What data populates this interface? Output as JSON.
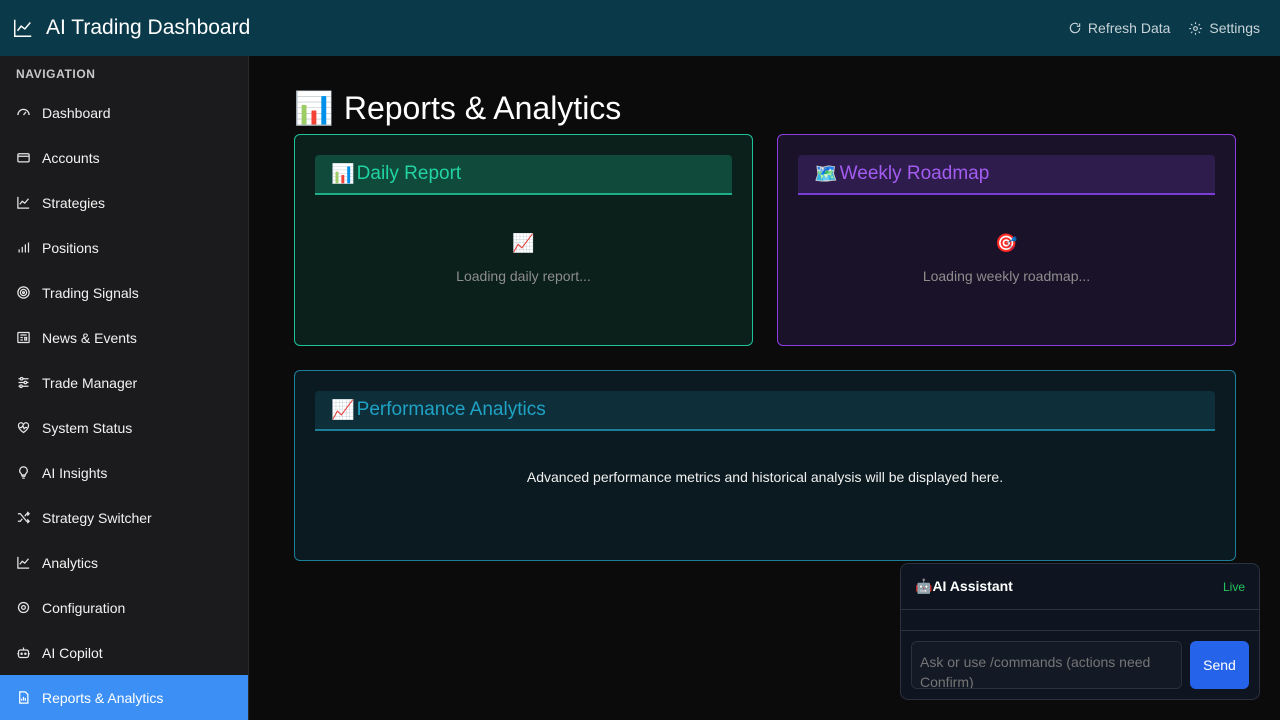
{
  "header": {
    "title": "AI Trading Dashboard",
    "refresh_label": "Refresh Data",
    "settings_label": "Settings"
  },
  "sidebar": {
    "heading": "NAVIGATION",
    "items": [
      {
        "label": "Dashboard",
        "icon": "gauge-icon"
      },
      {
        "label": "Accounts",
        "icon": "wallet-icon"
      },
      {
        "label": "Strategies",
        "icon": "line-chart-icon"
      },
      {
        "label": "Positions",
        "icon": "bar-chart-icon"
      },
      {
        "label": "Trading Signals",
        "icon": "target-icon"
      },
      {
        "label": "News & Events",
        "icon": "newspaper-icon"
      },
      {
        "label": "Trade Manager",
        "icon": "sliders-icon"
      },
      {
        "label": "System Status",
        "icon": "heart-pulse-icon"
      },
      {
        "label": "AI Insights",
        "icon": "lightbulb-icon"
      },
      {
        "label": "Strategy Switcher",
        "icon": "shuffle-icon"
      },
      {
        "label": "Analytics",
        "icon": "line-chart-icon"
      },
      {
        "label": "Configuration",
        "icon": "gear-icon"
      },
      {
        "label": "AI Copilot",
        "icon": "robot-icon"
      },
      {
        "label": "Reports & Analytics",
        "icon": "report-icon",
        "active": true
      }
    ]
  },
  "main": {
    "title_emoji": "📊",
    "title": "Reports & Analytics",
    "daily": {
      "emoji": "📊",
      "title": "Daily Report",
      "body_emoji": "📈",
      "loading": "Loading daily report..."
    },
    "weekly": {
      "emoji": "🗺️",
      "title": "Weekly Roadmap",
      "body_emoji": "🎯",
      "loading": "Loading weekly roadmap..."
    },
    "performance": {
      "emoji": "📈",
      "title": "Performance Analytics",
      "text": "Advanced performance metrics and historical analysis will be displayed here."
    }
  },
  "assistant": {
    "emoji": "🤖",
    "title": "AI Assistant",
    "status": "Live",
    "placeholder": "Ask or use /commands (actions need Confirm)",
    "send_label": "Send"
  },
  "colors": {
    "header_bg": "#0a3a4a",
    "active_nav": "#3b8ff5",
    "daily_accent": "#22d3a3",
    "weekly_accent": "#a45cf0",
    "perf_accent": "#1fa2c4",
    "send_button": "#2563eb",
    "live": "#22c55e"
  }
}
